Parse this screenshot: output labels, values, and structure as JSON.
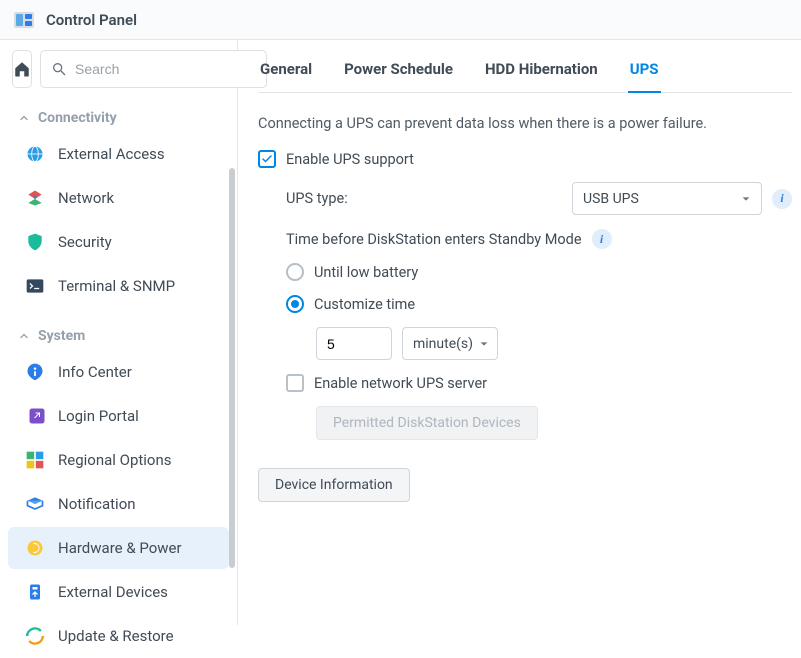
{
  "titlebar": {
    "title": "Control Panel"
  },
  "search": {
    "placeholder": "Search"
  },
  "sidebar": {
    "sections": [
      {
        "label": "Connectivity",
        "items": [
          {
            "icon": "globe",
            "label": "External Access"
          },
          {
            "icon": "network",
            "label": "Network"
          },
          {
            "icon": "shield",
            "label": "Security"
          },
          {
            "icon": "terminal",
            "label": "Terminal & SNMP"
          }
        ]
      },
      {
        "label": "System",
        "items": [
          {
            "icon": "info",
            "label": "Info Center"
          },
          {
            "icon": "portal",
            "label": "Login Portal"
          },
          {
            "icon": "regional",
            "label": "Regional Options"
          },
          {
            "icon": "notification",
            "label": "Notification"
          },
          {
            "icon": "hardware",
            "label": "Hardware & Power",
            "active": true
          },
          {
            "icon": "external",
            "label": "External Devices"
          },
          {
            "icon": "update",
            "label": "Update & Restore"
          }
        ]
      }
    ]
  },
  "tabs": [
    "General",
    "Power Schedule",
    "HDD Hibernation",
    "UPS"
  ],
  "active_tab": "UPS",
  "ups": {
    "description": "Connecting a UPS can prevent data loss when there is a power failure.",
    "enable_label": "Enable UPS support",
    "enable_checked": true,
    "type_label": "UPS type:",
    "type_value": "USB UPS",
    "standby_label": "Time before DiskStation enters Standby Mode",
    "radio_until": "Until low battery",
    "radio_custom": "Customize time",
    "radio_selected": "custom",
    "time_value": "5",
    "time_unit": "minute(s)",
    "network_server_label": "Enable network UPS server",
    "network_server_checked": false,
    "permitted_button": "Permitted DiskStation Devices",
    "device_info_button": "Device Information"
  }
}
